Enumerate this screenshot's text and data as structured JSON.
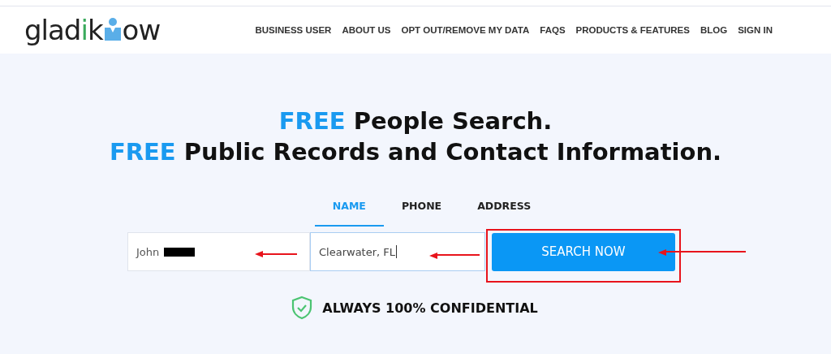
{
  "logo": {
    "parts": [
      {
        "text": "glad",
        "color": "#222222"
      },
      {
        "text": "i",
        "color": "#3aaa5c"
      },
      {
        "text": "k",
        "color": "#222222"
      },
      {
        "text": "ow",
        "color": "#222222"
      }
    ]
  },
  "nav": [
    "BUSINESS USER",
    "ABOUT US",
    "OPT OUT/REMOVE MY DATA",
    "FAQS",
    "PRODUCTS & FEATURES",
    "BLOG",
    "SIGN IN"
  ],
  "headline": [
    {
      "accent": "FREE",
      "text": "People Search."
    },
    {
      "accent": "FREE",
      "text": "Public Records and Contact Information."
    }
  ],
  "tabs": [
    {
      "label": "NAME",
      "selected": true
    },
    {
      "label": "PHONE",
      "selected": false
    },
    {
      "label": "ADDRESS",
      "selected": false
    }
  ],
  "fields": [
    {
      "value": "John",
      "redacted": true
    },
    {
      "value": "Clearwater, FL",
      "redacted": false
    }
  ],
  "search_button": "SEARCH NOW",
  "confidential": "ALWAYS 100% CONFIDENTIAL"
}
